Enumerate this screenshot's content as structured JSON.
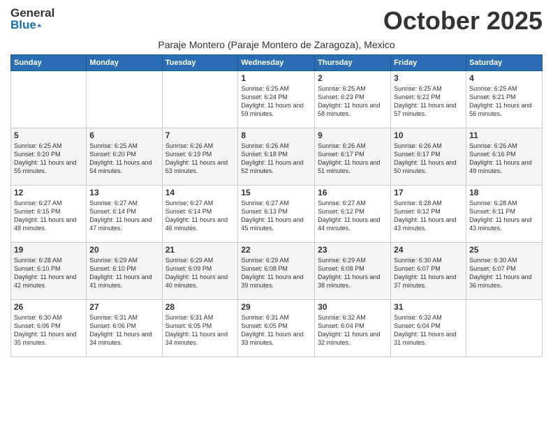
{
  "logo": {
    "general": "General",
    "blue": "Blue"
  },
  "header": {
    "month": "October 2025",
    "location": "Paraje Montero (Paraje Montero de Zaragoza), Mexico"
  },
  "days_of_week": [
    "Sunday",
    "Monday",
    "Tuesday",
    "Wednesday",
    "Thursday",
    "Friday",
    "Saturday"
  ],
  "weeks": [
    [
      {
        "day": "",
        "info": ""
      },
      {
        "day": "",
        "info": ""
      },
      {
        "day": "",
        "info": ""
      },
      {
        "day": "1",
        "info": "Sunrise: 6:25 AM\nSunset: 6:24 PM\nDaylight: 11 hours and 59 minutes."
      },
      {
        "day": "2",
        "info": "Sunrise: 6:25 AM\nSunset: 6:23 PM\nDaylight: 11 hours and 58 minutes."
      },
      {
        "day": "3",
        "info": "Sunrise: 6:25 AM\nSunset: 6:22 PM\nDaylight: 11 hours and 57 minutes."
      },
      {
        "day": "4",
        "info": "Sunrise: 6:25 AM\nSunset: 6:21 PM\nDaylight: 11 hours and 56 minutes."
      }
    ],
    [
      {
        "day": "5",
        "info": "Sunrise: 6:25 AM\nSunset: 6:20 PM\nDaylight: 11 hours and 55 minutes."
      },
      {
        "day": "6",
        "info": "Sunrise: 6:25 AM\nSunset: 6:20 PM\nDaylight: 11 hours and 54 minutes."
      },
      {
        "day": "7",
        "info": "Sunrise: 6:26 AM\nSunset: 6:19 PM\nDaylight: 11 hours and 53 minutes."
      },
      {
        "day": "8",
        "info": "Sunrise: 6:26 AM\nSunset: 6:18 PM\nDaylight: 11 hours and 52 minutes."
      },
      {
        "day": "9",
        "info": "Sunrise: 6:26 AM\nSunset: 6:17 PM\nDaylight: 11 hours and 51 minutes."
      },
      {
        "day": "10",
        "info": "Sunrise: 6:26 AM\nSunset: 6:17 PM\nDaylight: 11 hours and 50 minutes."
      },
      {
        "day": "11",
        "info": "Sunrise: 6:26 AM\nSunset: 6:16 PM\nDaylight: 11 hours and 49 minutes."
      }
    ],
    [
      {
        "day": "12",
        "info": "Sunrise: 6:27 AM\nSunset: 6:15 PM\nDaylight: 11 hours and 48 minutes."
      },
      {
        "day": "13",
        "info": "Sunrise: 6:27 AM\nSunset: 6:14 PM\nDaylight: 11 hours and 47 minutes."
      },
      {
        "day": "14",
        "info": "Sunrise: 6:27 AM\nSunset: 6:14 PM\nDaylight: 11 hours and 46 minutes."
      },
      {
        "day": "15",
        "info": "Sunrise: 6:27 AM\nSunset: 6:13 PM\nDaylight: 11 hours and 45 minutes."
      },
      {
        "day": "16",
        "info": "Sunrise: 6:27 AM\nSunset: 6:12 PM\nDaylight: 11 hours and 44 minutes."
      },
      {
        "day": "17",
        "info": "Sunrise: 6:28 AM\nSunset: 6:12 PM\nDaylight: 11 hours and 43 minutes."
      },
      {
        "day": "18",
        "info": "Sunrise: 6:28 AM\nSunset: 6:11 PM\nDaylight: 11 hours and 43 minutes."
      }
    ],
    [
      {
        "day": "19",
        "info": "Sunrise: 6:28 AM\nSunset: 6:10 PM\nDaylight: 11 hours and 42 minutes."
      },
      {
        "day": "20",
        "info": "Sunrise: 6:29 AM\nSunset: 6:10 PM\nDaylight: 11 hours and 41 minutes."
      },
      {
        "day": "21",
        "info": "Sunrise: 6:29 AM\nSunset: 6:09 PM\nDaylight: 11 hours and 40 minutes."
      },
      {
        "day": "22",
        "info": "Sunrise: 6:29 AM\nSunset: 6:08 PM\nDaylight: 11 hours and 39 minutes."
      },
      {
        "day": "23",
        "info": "Sunrise: 6:29 AM\nSunset: 6:08 PM\nDaylight: 11 hours and 38 minutes."
      },
      {
        "day": "24",
        "info": "Sunrise: 6:30 AM\nSunset: 6:07 PM\nDaylight: 11 hours and 37 minutes."
      },
      {
        "day": "25",
        "info": "Sunrise: 6:30 AM\nSunset: 6:07 PM\nDaylight: 11 hours and 36 minutes."
      }
    ],
    [
      {
        "day": "26",
        "info": "Sunrise: 6:30 AM\nSunset: 6:06 PM\nDaylight: 11 hours and 35 minutes."
      },
      {
        "day": "27",
        "info": "Sunrise: 6:31 AM\nSunset: 6:06 PM\nDaylight: 11 hours and 34 minutes."
      },
      {
        "day": "28",
        "info": "Sunrise: 6:31 AM\nSunset: 6:05 PM\nDaylight: 11 hours and 34 minutes."
      },
      {
        "day": "29",
        "info": "Sunrise: 6:31 AM\nSunset: 6:05 PM\nDaylight: 11 hours and 33 minutes."
      },
      {
        "day": "30",
        "info": "Sunrise: 6:32 AM\nSunset: 6:04 PM\nDaylight: 11 hours and 32 minutes."
      },
      {
        "day": "31",
        "info": "Sunrise: 6:32 AM\nSunset: 6:04 PM\nDaylight: 11 hours and 31 minutes."
      },
      {
        "day": "",
        "info": ""
      }
    ]
  ]
}
